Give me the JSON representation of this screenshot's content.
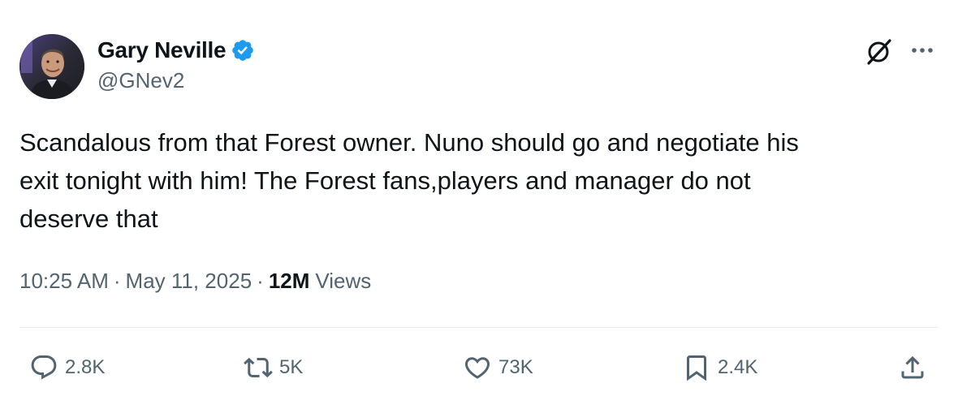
{
  "author": {
    "display_name": "Gary Neville",
    "handle": "@GNev2",
    "avatar_icon": "profile-photo",
    "verified_icon": "verified-badge-icon",
    "verified_color": "#1d9bf0"
  },
  "tweet": {
    "text": "Scandalous from that Forest owner. Nuno should go and negotiate his\nexit tonight with him! The Forest fans,players and manager do not\ndeserve that"
  },
  "meta": {
    "time": "10:25 AM",
    "separator": "·",
    "date": "May 11, 2025",
    "views_count": "12M",
    "views_label": "Views"
  },
  "header_actions": {
    "grok_icon": "grok-icon",
    "more_icon": "more-options-icon"
  },
  "actions": {
    "reply": {
      "icon": "reply-icon",
      "count": "2.8K"
    },
    "repost": {
      "icon": "repost-icon",
      "count": "5K"
    },
    "like": {
      "icon": "heart-icon",
      "count": "73K"
    },
    "bookmark": {
      "icon": "bookmark-icon",
      "count": "2.4K"
    },
    "share": {
      "icon": "share-icon"
    }
  },
  "colors": {
    "text_primary": "#0f1419",
    "text_secondary": "#536471",
    "divider": "#e6ecf0"
  }
}
